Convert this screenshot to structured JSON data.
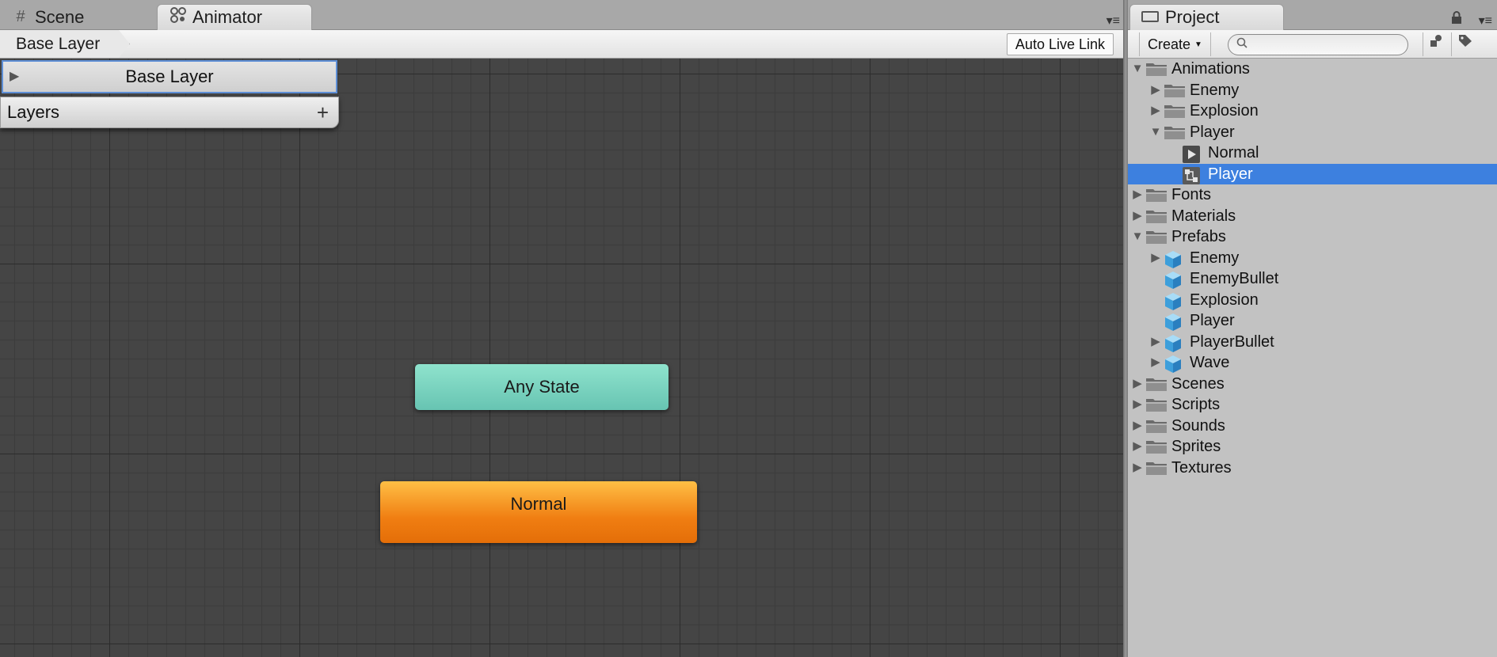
{
  "animator": {
    "tabs": [
      {
        "label": "Scene",
        "icon": "grid-icon"
      },
      {
        "label": "Animator",
        "icon": "animator-icon"
      }
    ],
    "breadcrumb": "Base Layer",
    "auto_live_link": "Auto Live Link",
    "layer_row": "Base Layer",
    "layers_header": "Layers",
    "add_layer": "+",
    "states": {
      "any_state": "Any State",
      "normal": "Normal"
    },
    "colors": {
      "any_state": "#7ad6c2",
      "normal_state": "#f5921f",
      "canvas": "#454545"
    }
  },
  "project": {
    "tab": "Project",
    "create": "Create",
    "search_placeholder": "",
    "tree": [
      {
        "label": "Animations",
        "kind": "folder",
        "depth": 0,
        "expanded": true
      },
      {
        "label": "Enemy",
        "kind": "folder",
        "depth": 1,
        "expanded": false
      },
      {
        "label": "Explosion",
        "kind": "folder",
        "depth": 1,
        "expanded": false
      },
      {
        "label": "Player",
        "kind": "folder",
        "depth": 1,
        "expanded": true
      },
      {
        "label": "Normal",
        "kind": "animation-clip",
        "depth": 2
      },
      {
        "label": "Player",
        "kind": "animator-controller",
        "depth": 2,
        "selected": true
      },
      {
        "label": "Fonts",
        "kind": "folder",
        "depth": 0,
        "expanded": false
      },
      {
        "label": "Materials",
        "kind": "folder",
        "depth": 0,
        "expanded": false
      },
      {
        "label": "Prefabs",
        "kind": "folder",
        "depth": 0,
        "expanded": true
      },
      {
        "label": "Enemy",
        "kind": "prefab",
        "depth": 1,
        "expandable": true
      },
      {
        "label": "EnemyBullet",
        "kind": "prefab",
        "depth": 1
      },
      {
        "label": "Explosion",
        "kind": "prefab",
        "depth": 1
      },
      {
        "label": "Player",
        "kind": "prefab",
        "depth": 1
      },
      {
        "label": "PlayerBullet",
        "kind": "prefab",
        "depth": 1,
        "expandable": true
      },
      {
        "label": "Wave",
        "kind": "prefab",
        "depth": 1,
        "expandable": true
      },
      {
        "label": "Scenes",
        "kind": "folder",
        "depth": 0,
        "expanded": false
      },
      {
        "label": "Scripts",
        "kind": "folder",
        "depth": 0,
        "expanded": false
      },
      {
        "label": "Sounds",
        "kind": "folder",
        "depth": 0,
        "expanded": false
      },
      {
        "label": "Sprites",
        "kind": "folder",
        "depth": 0,
        "expanded": false
      },
      {
        "label": "Textures",
        "kind": "folder",
        "depth": 0,
        "expanded": false
      }
    ],
    "selection_color": "#3d80df"
  }
}
